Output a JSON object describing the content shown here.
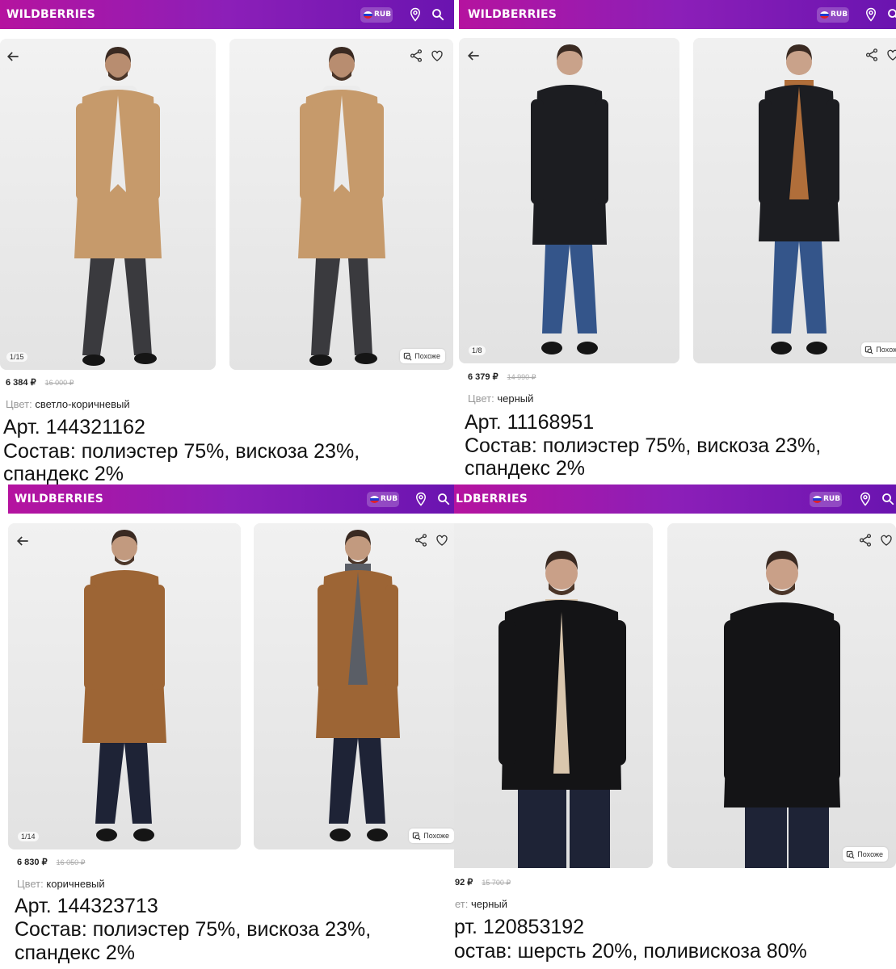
{
  "panels": [
    {
      "brand": "WILDBERRIES",
      "currency": "RUB",
      "counter": "1/15",
      "similar_label": "Похоже",
      "price": "6 384 ₽",
      "old_price": "16 000 ₽",
      "color_label": "Цвет:",
      "color_value": "светло-коричневый",
      "article": "Арт. 144321162",
      "composition_1": "Состав: полиэстер 75%, вискоза 23%,",
      "composition_2": "спандекс 2%",
      "coat_color": "#c69a6b"
    },
    {
      "brand": "WILDBERRIES",
      "currency": "RUB",
      "counter": "1/8",
      "similar_label": "Похоже",
      "price": "6 379 ₽",
      "old_price": "14 990 ₽",
      "color_label": "Цвет:",
      "color_value": "черный",
      "article": "Арт. 11168951",
      "composition_1": "Состав: полиэстер 75%, вискоза 23%,",
      "composition_2": "спандекс 2%",
      "coat_color": "#1c1d21"
    },
    {
      "brand": "WILDBERRIES",
      "currency": "RUB",
      "counter": "1/14",
      "similar_label": "Похоже",
      "price": "6 830 ₽",
      "old_price": "16 050 ₽",
      "color_label": "Цвет:",
      "color_value": "коричневый",
      "article": "Арт. 144323713",
      "composition_1": "Состав: полиэстер 75%, вискоза 23%,",
      "composition_2": "спандекс 2%",
      "coat_color": "#9d6535"
    },
    {
      "brand": "LDBERRIES",
      "currency": "RUB",
      "counter": "",
      "similar_label": "Похоже",
      "price": "92 ₽",
      "old_price": "15 700 ₽",
      "color_label": "ет:",
      "color_value": "черный",
      "article": "рт. 120853192",
      "composition_1": "остав: шерсть 20%, поливискоза 80%",
      "composition_2": "",
      "coat_color": "#141416"
    }
  ],
  "icons": {
    "back": "back-arrow-icon",
    "share": "share-icon",
    "favorite": "heart-icon",
    "location": "location-pin-icon",
    "search": "search-icon",
    "flag": "russia-flag-icon",
    "similar": "similar-search-icon"
  },
  "colors": {
    "header_start": "#b5139f",
    "header_end": "#6a14b0"
  }
}
